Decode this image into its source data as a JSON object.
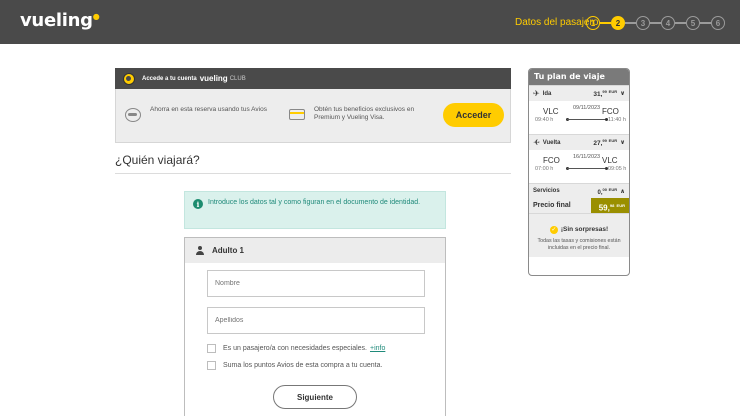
{
  "header": {
    "logo": "vueling",
    "steps_label": "Datos del pasajero",
    "steps": [
      "1",
      "2",
      "3",
      "4",
      "5",
      "6"
    ],
    "active_step": "2"
  },
  "club": {
    "access_text": "Accede a tu cuenta",
    "brand": "vueling",
    "club_word": "CLUB",
    "avios_text": "Ahorra en esta reserva usando tus Avios",
    "benefits_text": "Obtén tus beneficios exclusivos en Premium y Vueling Visa.",
    "login_button": "Acceder"
  },
  "passengers": {
    "title": "¿Quién viajará?",
    "info_icon": "i",
    "info_text": "Introduce los datos tal y como figuran en el documento de identidad.",
    "adult_label": "Adulto 1",
    "name_placeholder": "Nombre",
    "surname_placeholder": "Apellidos",
    "special_needs_text": "Es un pasajero/a con necesidades especiales.",
    "special_needs_link": "+info",
    "avios_points_text": "Suma los puntos Avios de esta compra a tu cuenta.",
    "next_button": "Siguiente"
  },
  "plan": {
    "title": "Tu plan de viaje",
    "outbound": {
      "label": "Ida",
      "price_int": "31,",
      "price_dec": "99",
      "currency": "EUR",
      "from": "VLC",
      "to": "FCO",
      "date": "09/11/2023",
      "dep_time": "09:40 h",
      "arr_time": "11:40 h"
    },
    "return": {
      "label": "Vuelta",
      "price_int": "27,",
      "price_dec": "99",
      "currency": "EUR",
      "from": "FCO",
      "to": "VLC",
      "date": "16/11/2023",
      "dep_time": "07:00 h",
      "arr_time": "09:05 h"
    },
    "services": {
      "label": "Servicios",
      "price_int": "0,",
      "price_dec": "00",
      "currency": "EUR"
    },
    "final": {
      "label": "Precio final",
      "price_int": "59,",
      "price_dec": "98",
      "currency": "EUR"
    },
    "no_surprises_title": "¡Sin sorpresas!",
    "no_surprises_text": "Todas las tasas y comisiones están incluidas en el precio final."
  },
  "colors": {
    "brand_yellow": "#ffcc00",
    "header_gray": "#4a4a4a",
    "final_price_bg": "#9a8f00",
    "info_teal": "#1f8a7a"
  }
}
